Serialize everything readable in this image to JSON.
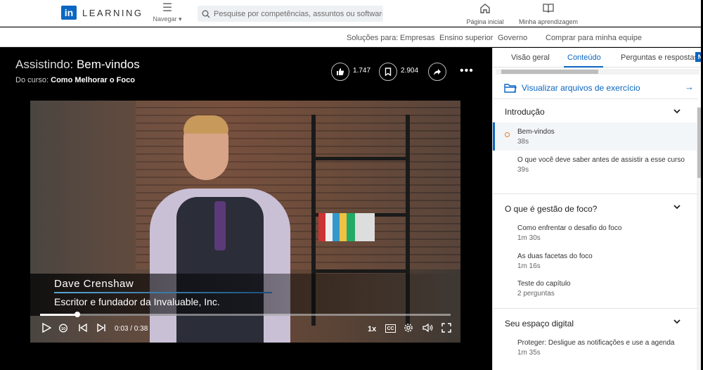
{
  "topnav": {
    "logo_mark": "in",
    "logo_text": "LEARNING",
    "navigate_label": "Navegar",
    "search_placeholder": "Pesquise por competências, assuntos ou software",
    "home_label": "Página inicial",
    "my_learning_label": "Minha aprendizagem"
  },
  "subnav": {
    "solutions_label": "Soluções para:",
    "items": [
      "Empresas",
      "Ensino superior",
      "Governo"
    ],
    "buy_label": "Comprar para minha equipe"
  },
  "player": {
    "watching_prefix": "Assistindo:",
    "watching_title": "Bem-vindos",
    "course_prefix": "Do curso:",
    "course_name": "Como Melhorar o Foco",
    "likes": "1.747",
    "saves": "2.904",
    "more_label": "•••",
    "lower_third_name": "Dave Crenshaw",
    "lower_third_title": "Escritor e fundador da Invaluable, Inc.",
    "time_display": "0:03 / 0:38",
    "progress_percent": 9,
    "speed": "1x",
    "cc_label": "CC"
  },
  "sidebar": {
    "tabs": [
      "Visão geral",
      "Conteúdo",
      "Perguntas e respostas"
    ],
    "badge": "N",
    "exercise_files": "Visualizar arquivos de exercício",
    "chapters": [
      {
        "title": "Introdução",
        "items": [
          {
            "title": "Bem-vindos",
            "duration": "38s"
          },
          {
            "title": "O que você deve saber antes de assistir a esse curso",
            "duration": "39s"
          }
        ]
      },
      {
        "title": "O que é gestão de foco?",
        "items": [
          {
            "title": "Como enfrentar o desafio do foco",
            "duration": "1m 30s"
          },
          {
            "title": "As duas facetas do foco",
            "duration": "1m 16s"
          },
          {
            "title": "Teste do capítulo",
            "duration": "2 perguntas"
          }
        ]
      },
      {
        "title": "Seu espaço digital",
        "items": [
          {
            "title": "Proteger: Desligue as notificações e use a agenda",
            "duration": "1m 35s"
          }
        ]
      }
    ]
  },
  "colors": {
    "accent": "#0a66c2",
    "active_dot": "#e07a2f"
  }
}
